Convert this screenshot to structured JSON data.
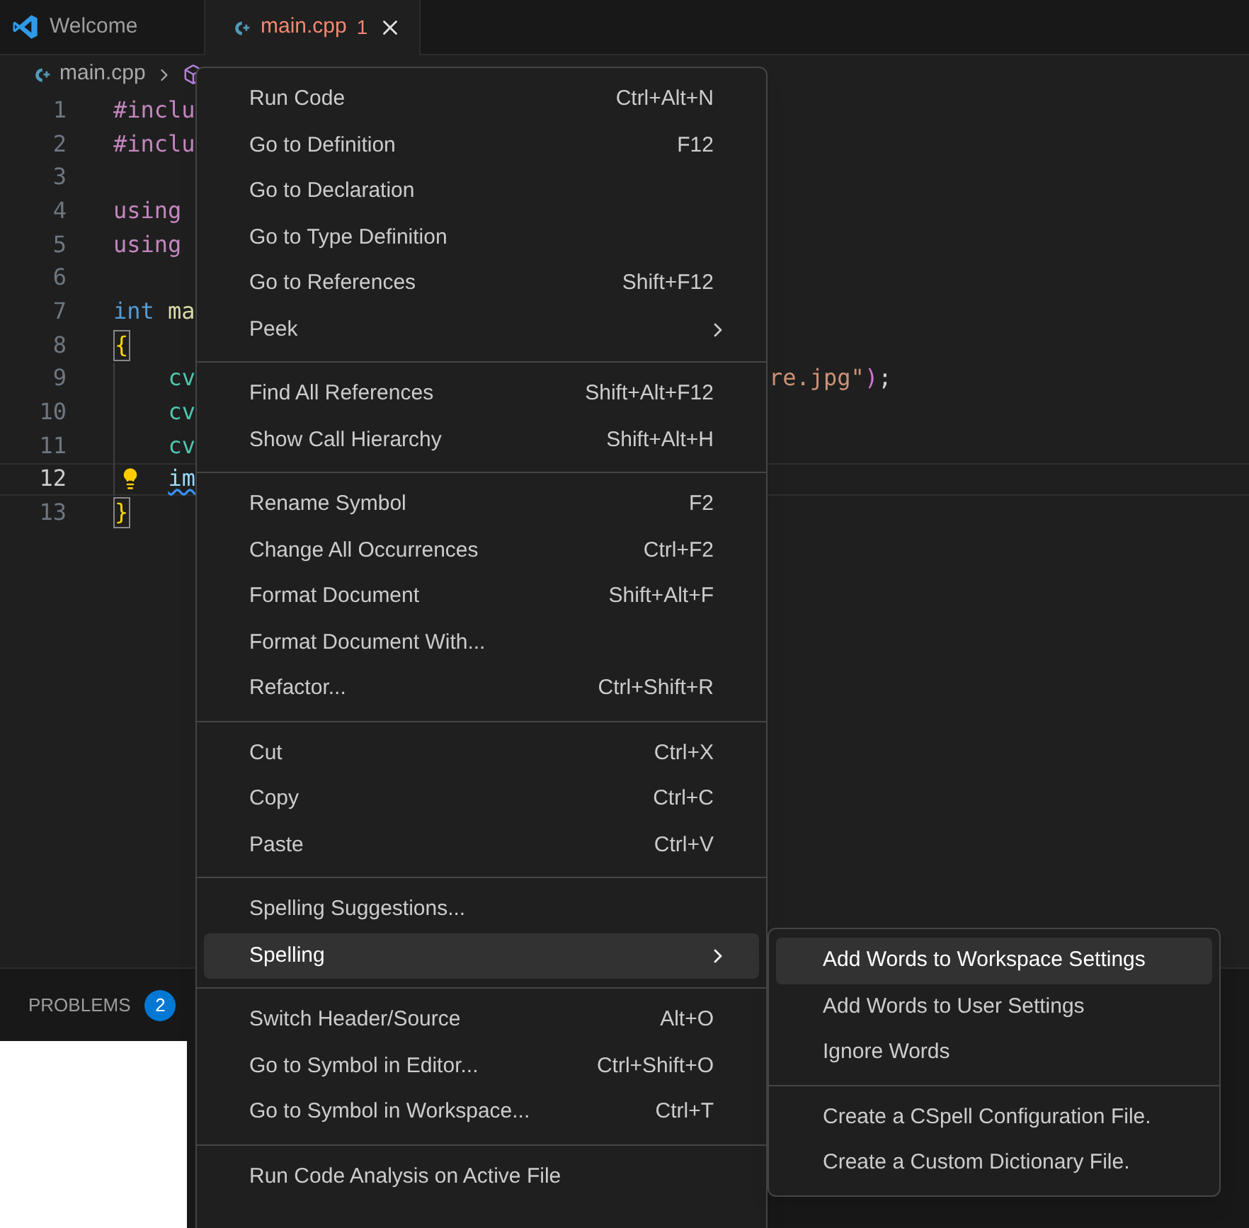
{
  "tabs": [
    {
      "label": "Welcome",
      "kind": "welcome",
      "selected": false
    },
    {
      "label": "main.cpp",
      "kind": "cpp",
      "problem_count": "1",
      "selected": true
    }
  ],
  "breadcrumb": {
    "file": "main.cpp"
  },
  "editor": {
    "lines": [
      {
        "number": "1",
        "current": false,
        "tokens": [
          {
            "kind": "directive",
            "text": "#inclu"
          }
        ]
      },
      {
        "number": "2",
        "current": false,
        "tokens": [
          {
            "kind": "directive",
            "text": "#inclu"
          }
        ]
      },
      {
        "number": "3",
        "current": false
      },
      {
        "number": "4",
        "current": false,
        "tokens": [
          {
            "kind": "directive",
            "text": "using"
          }
        ]
      },
      {
        "number": "5",
        "current": false,
        "tokens": [
          {
            "kind": "directive",
            "text": "using"
          }
        ]
      },
      {
        "number": "6",
        "current": false
      },
      {
        "number": "7",
        "current": false,
        "tokens": [
          {
            "kind": "type",
            "text": "int"
          },
          {
            "kind": "function",
            "text": "ma"
          }
        ]
      },
      {
        "number": "8",
        "current": false,
        "tokens": [
          {
            "kind": "brace",
            "text": "{",
            "matched": true
          }
        ]
      },
      {
        "number": "9",
        "current": false,
        "indented": true,
        "tokens": [
          {
            "kind": "class",
            "text": "cv"
          }
        ],
        "tail": [
          {
            "kind": "string",
            "text": "re.jpg\""
          },
          {
            "kind": "paren",
            "text": ")"
          },
          {
            "kind": "plain",
            "text": ";"
          }
        ]
      },
      {
        "number": "10",
        "current": false,
        "indented": true,
        "tokens": [
          {
            "kind": "class",
            "text": "cv"
          }
        ]
      },
      {
        "number": "11",
        "current": false,
        "indented": true,
        "tokens": [
          {
            "kind": "class",
            "text": "cv"
          }
        ]
      },
      {
        "number": "12",
        "current": true,
        "indented": true,
        "lightbulb": true,
        "tokens": [
          {
            "kind": "variable",
            "text": "im",
            "warning": true
          }
        ]
      },
      {
        "number": "13",
        "current": false,
        "tokens": [
          {
            "kind": "brace",
            "text": "}",
            "matched": true
          }
        ]
      }
    ]
  },
  "context_menu": {
    "groups": [
      [
        {
          "label": "Run Code",
          "shortcut": "Ctrl+Alt+N",
          "submenu": false,
          "selected": false
        },
        {
          "label": "Go to Definition",
          "shortcut": "F12",
          "submenu": false,
          "selected": false
        },
        {
          "label": "Go to Declaration",
          "submenu": false,
          "selected": false
        },
        {
          "label": "Go to Type Definition",
          "submenu": false,
          "selected": false
        },
        {
          "label": "Go to References",
          "shortcut": "Shift+F12",
          "submenu": false,
          "selected": false
        },
        {
          "label": "Peek",
          "submenu": true,
          "selected": false
        }
      ],
      [
        {
          "label": "Find All References",
          "shortcut": "Shift+Alt+F12",
          "submenu": false,
          "selected": false
        },
        {
          "label": "Show Call Hierarchy",
          "shortcut": "Shift+Alt+H",
          "submenu": false,
          "selected": false
        }
      ],
      [
        {
          "label": "Rename Symbol",
          "shortcut": "F2",
          "submenu": false,
          "selected": false
        },
        {
          "label": "Change All Occurrences",
          "shortcut": "Ctrl+F2",
          "submenu": false,
          "selected": false
        },
        {
          "label": "Format Document",
          "shortcut": "Shift+Alt+F",
          "submenu": false,
          "selected": false
        },
        {
          "label": "Format Document With...",
          "submenu": false,
          "selected": false
        },
        {
          "label": "Refactor...",
          "shortcut": "Ctrl+Shift+R",
          "submenu": false,
          "selected": false
        }
      ],
      [
        {
          "label": "Cut",
          "shortcut": "Ctrl+X",
          "submenu": false,
          "selected": false
        },
        {
          "label": "Copy",
          "shortcut": "Ctrl+C",
          "submenu": false,
          "selected": false
        },
        {
          "label": "Paste",
          "shortcut": "Ctrl+V",
          "submenu": false,
          "selected": false
        }
      ],
      [
        {
          "label": "Spelling Suggestions...",
          "submenu": false,
          "selected": false
        },
        {
          "label": "Spelling",
          "submenu": true,
          "selected": true
        }
      ],
      [
        {
          "label": "Switch Header/Source",
          "shortcut": "Alt+O",
          "submenu": false,
          "selected": false
        },
        {
          "label": "Go to Symbol in Editor...",
          "shortcut": "Ctrl+Shift+O",
          "submenu": false,
          "selected": false
        },
        {
          "label": "Go to Symbol in Workspace...",
          "shortcut": "Ctrl+T",
          "submenu": false,
          "selected": false
        }
      ],
      [
        {
          "label": "Run Code Analysis on Active File",
          "submenu": false,
          "selected": false
        }
      ]
    ]
  },
  "submenu": {
    "groups": [
      [
        {
          "label": "Add Words to Workspace Settings",
          "selected": true
        },
        {
          "label": "Add Words to User Settings",
          "selected": false
        },
        {
          "label": "Ignore Words",
          "selected": false
        }
      ],
      [
        {
          "label": "Create a CSpell Configuration File.",
          "selected": false
        },
        {
          "label": "Create a Custom Dictionary File.",
          "selected": false
        }
      ]
    ]
  },
  "panel": {
    "tabs": [
      {
        "label": "PROBLEMS",
        "count": "2"
      }
    ]
  }
}
